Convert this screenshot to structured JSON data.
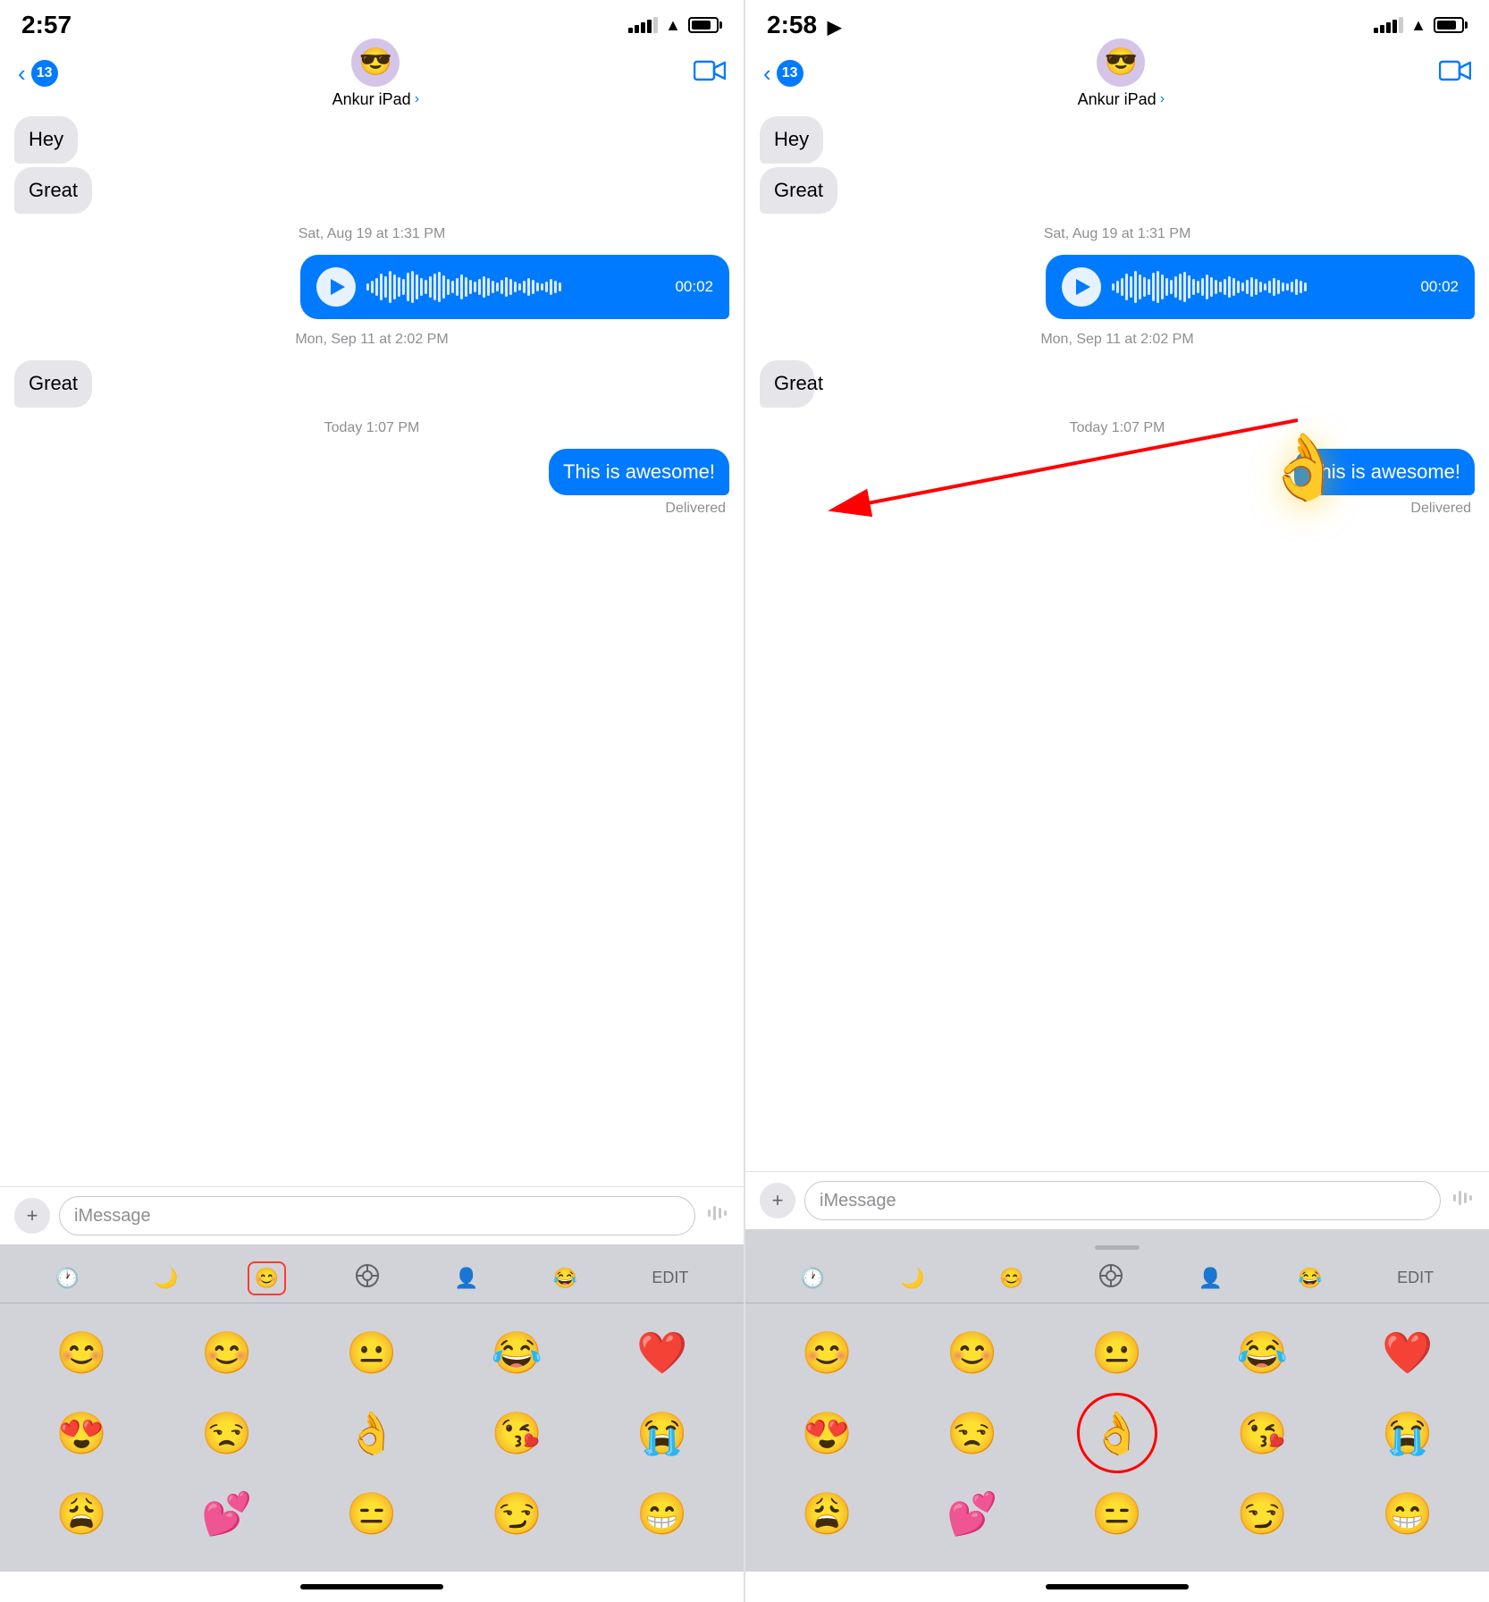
{
  "left": {
    "statusBar": {
      "time": "2:57",
      "signalBars": [
        6,
        9,
        12,
        15,
        18
      ],
      "batteryPercent": 85
    },
    "nav": {
      "backCount": "13",
      "contactName": "Ankur iPad",
      "avatarEmoji": "😎"
    },
    "messages": [
      {
        "type": "received",
        "text": "Hey"
      },
      {
        "type": "received",
        "text": "Great"
      },
      {
        "timestamp": "Sat, Aug 19 at 1:31 PM"
      },
      {
        "type": "audio",
        "duration": "00:02"
      },
      {
        "timestamp": "Mon, Sep 11 at 2:02 PM"
      },
      {
        "type": "received",
        "text": "Great"
      },
      {
        "timestamp": "Today 1:07 PM"
      },
      {
        "type": "sent",
        "text": "This is awesome!"
      },
      {
        "type": "delivered",
        "text": "Delivered"
      }
    ],
    "input": {
      "placeholder": "iMessage"
    },
    "emojiTabs": [
      {
        "icon": "🕐",
        "active": false
      },
      {
        "icon": "🌙",
        "active": false
      },
      {
        "icon": "😊",
        "active": true
      },
      {
        "icon": "🎯",
        "active": false
      },
      {
        "icon": "👤",
        "active": false
      },
      {
        "icon": "😂",
        "active": false
      },
      {
        "label": "EDIT",
        "active": false
      }
    ],
    "emojiGrid": [
      "😊",
      "😊",
      "😐",
      "😂",
      "❤️",
      "😍",
      "😒",
      "👌",
      "😘",
      "😭",
      "😩",
      "💕",
      "😑",
      "😏",
      "😁"
    ]
  },
  "right": {
    "statusBar": {
      "time": "2:58",
      "hasArrow": true
    },
    "nav": {
      "backCount": "13",
      "contactName": "Ankur iPad",
      "avatarEmoji": "😎"
    },
    "messages": [
      {
        "type": "received",
        "text": "Hey"
      },
      {
        "type": "received",
        "text": "Great"
      },
      {
        "timestamp": "Sat, Aug 19 at 1:31 PM"
      },
      {
        "type": "audio",
        "duration": "00:02"
      },
      {
        "timestamp": "Mon, Sep 11 at 2:02 PM"
      },
      {
        "type": "received",
        "text": "Great",
        "hasAnnotation": true
      },
      {
        "timestamp": "Today 1:07 PM"
      },
      {
        "type": "sent",
        "text": "This is awesome!"
      },
      {
        "type": "delivered",
        "text": "Delivered"
      }
    ],
    "floatingEmoji": "👌",
    "input": {
      "placeholder": "iMessage"
    },
    "emojiTabs": [
      {
        "icon": "🕐",
        "active": false
      },
      {
        "icon": "🌙",
        "active": false
      },
      {
        "icon": "😊",
        "active": false
      },
      {
        "icon": "🎯",
        "active": false
      },
      {
        "icon": "👤",
        "active": false
      },
      {
        "icon": "😂",
        "active": false
      },
      {
        "label": "EDIT",
        "active": false
      }
    ],
    "emojiGrid": [
      "😊",
      "😊",
      "😐",
      "😂",
      "❤️",
      "😍",
      "😒",
      "👌",
      "😘",
      "😭",
      "😩",
      "💕",
      "😑",
      "😏",
      "😁"
    ],
    "okCircleIndex": 7
  },
  "labels": {
    "delivered": "Delivered",
    "edit": "EDIT",
    "imessage": "iMessage"
  }
}
